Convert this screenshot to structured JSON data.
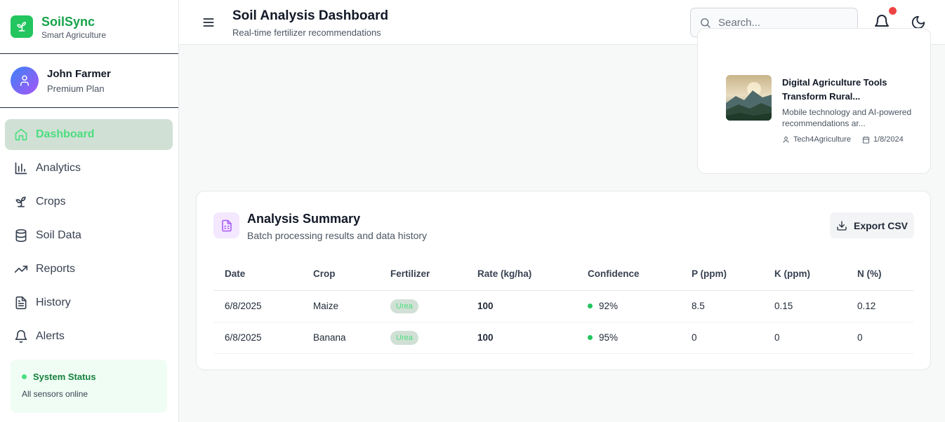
{
  "brand": {
    "name": "SoilSync",
    "subtitle": "Smart Agriculture"
  },
  "user": {
    "name": "John Farmer",
    "plan": "Premium Plan"
  },
  "nav": [
    {
      "label": "Dashboard",
      "icon": "home-icon",
      "active": true
    },
    {
      "label": "Analytics",
      "icon": "bar-chart-icon"
    },
    {
      "label": "Crops",
      "icon": "sprout-icon"
    },
    {
      "label": "Soil Data",
      "icon": "database-icon"
    },
    {
      "label": "Reports",
      "icon": "trending-up-icon"
    },
    {
      "label": "History",
      "icon": "file-text-icon"
    },
    {
      "label": "Alerts",
      "icon": "bell-icon"
    }
  ],
  "status": {
    "title": "System Status",
    "detail": "All sensors online"
  },
  "header": {
    "title": "Soil Analysis Dashboard",
    "subtitle": "Real-time fertilizer recommendations",
    "search_placeholder": "Search..."
  },
  "news": {
    "title": "Digital Agriculture Tools Transform Rural...",
    "description": "Mobile technology and AI-powered recommendations ar...",
    "author": "Tech4Agriculture",
    "date": "1/8/2024"
  },
  "summary": {
    "title": "Analysis Summary",
    "subtitle": "Batch processing results and data history",
    "export_label": "Export CSV",
    "columns": [
      "Date",
      "Crop",
      "Fertilizer",
      "Rate (kg/ha)",
      "Confidence",
      "P (ppm)",
      "K (ppm)",
      "N (%)"
    ],
    "rows": [
      {
        "date": "6/8/2025",
        "crop": "Maize",
        "fertilizer": "Urea",
        "rate": "100",
        "confidence": "92%",
        "p": "8.5",
        "k": "0.15",
        "n": "0.12"
      },
      {
        "date": "6/8/2025",
        "crop": "Banana",
        "fertilizer": "Urea",
        "rate": "100",
        "confidence": "95%",
        "p": "0",
        "k": "0",
        "n": "0"
      }
    ]
  },
  "colors": {
    "accent": "#22c55e",
    "accent_text": "#16a34a",
    "active_bg": "#d1e0d5",
    "notification": "#ef4444"
  }
}
